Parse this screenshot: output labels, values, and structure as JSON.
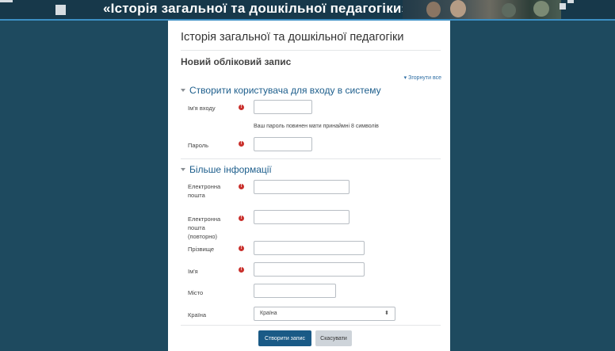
{
  "banner": {
    "title": "«Історія загальної та дошкільної педагогіки»"
  },
  "site": {
    "title": "Історія загальної та дошкільної педагогіки"
  },
  "page": {
    "title": "Новий обліковий запис",
    "collapse_all": "Згорнути все"
  },
  "sections": {
    "login": {
      "legend": "Створити користувача для входу в систему",
      "username_label": "Ім'я входу",
      "password_hint": "Ваш пароль повинен мати принаймні 8 символів",
      "password_label": "Пароль"
    },
    "more": {
      "legend": "Більше інформації",
      "email_label": "Електронна пошта",
      "email2_label": "Електронна пошта (повторно)",
      "lastname_label": "Прізвище",
      "firstname_label": "Ім'я",
      "city_label": "Місто",
      "country_label": "Країна",
      "country_selected": "Країна"
    }
  },
  "buttons": {
    "submit": "Створити запис",
    "cancel": "Скасувати"
  },
  "icons": {
    "required": "exclamation-circle-icon",
    "collapse": "caret-down-icon",
    "select": "up-down-arrows-icon"
  },
  "colors": {
    "background": "#1e4a5f",
    "brand": "#1a5a86",
    "link": "#1d5e8c",
    "required": "#c9302c"
  }
}
